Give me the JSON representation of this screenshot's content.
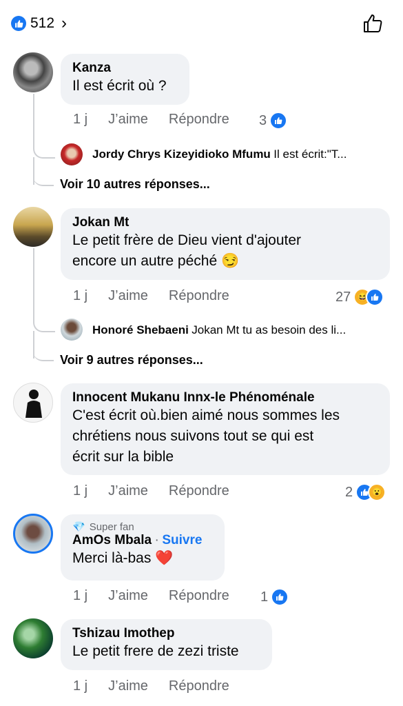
{
  "header": {
    "reaction_count": "512",
    "chevron": "›"
  },
  "comments": [
    {
      "author": "Kanza",
      "text": "Il est écrit où ?",
      "time": "1 j",
      "like_label": "J’aime",
      "reply_label": "Répondre",
      "reaction_count": "3",
      "reply_preview": {
        "author": "Jordy Chrys Kizeyidioko Mfumu",
        "text": "Il est écrit:\"T..."
      },
      "more_replies": "Voir 10 autres réponses..."
    },
    {
      "author": "Jokan Mt",
      "text_line1": "Le petit frère de Dieu vient d'ajouter",
      "text_line2": "encore un autre péché 😏",
      "time": "1 j",
      "like_label": "J’aime",
      "reply_label": "Répondre",
      "reaction_count": "27",
      "reply_preview": {
        "author": "Honoré Shebaeni",
        "text": "Jokan Mt tu as besoin des li..."
      },
      "more_replies": "Voir 9 autres réponses..."
    },
    {
      "author": "Innocent Mukanu Innx-le Phénoménale",
      "text_line1": "C'est écrit où.bien aimé nous sommes les",
      "text_line2": "chrétiens nous suivons tout se qui est",
      "text_line3": "écrit sur la bible",
      "time": "1 j",
      "like_label": "J’aime",
      "reply_label": "Répondre",
      "reaction_count": "2"
    },
    {
      "badge": "Super fan",
      "author": "AmOs Mbala",
      "follow": "Suivre",
      "text": "Merci là-bas ❤️",
      "time": "1 j",
      "like_label": "J’aime",
      "reply_label": "Répondre",
      "reaction_count": "1"
    },
    {
      "author": "Tshizau Imothep",
      "text": "Le petit frere de zezi triste",
      "time": "1 j",
      "like_label": "J’aime",
      "reply_label": "Répondre"
    }
  ],
  "colors": {
    "accent": "#1877f2",
    "bubble": "#f0f2f5",
    "muted": "#65676b"
  }
}
